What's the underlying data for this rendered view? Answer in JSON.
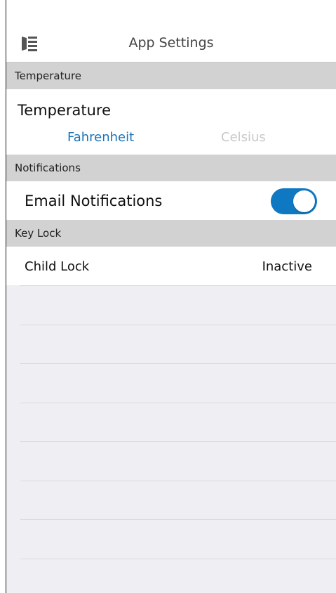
{
  "header": {
    "title": "App Settings",
    "menu_icon": "sidebar-menu-icon"
  },
  "sections": {
    "temperature": {
      "header": "Temperature",
      "title": "Temperature",
      "options": [
        "Fahrenheit",
        "Celsius"
      ],
      "selected": "Fahrenheit"
    },
    "notifications": {
      "header": "Notifications",
      "email_label": "Email Notifications",
      "email_enabled": true
    },
    "key_lock": {
      "header": "Key Lock",
      "child_lock_label": "Child Lock",
      "child_lock_value": "Inactive"
    }
  },
  "colors": {
    "accent": "#0f78c2",
    "inactive_text": "#c8c8c8",
    "section_bg": "#d2d2d2",
    "page_bg": "#efeef3"
  }
}
